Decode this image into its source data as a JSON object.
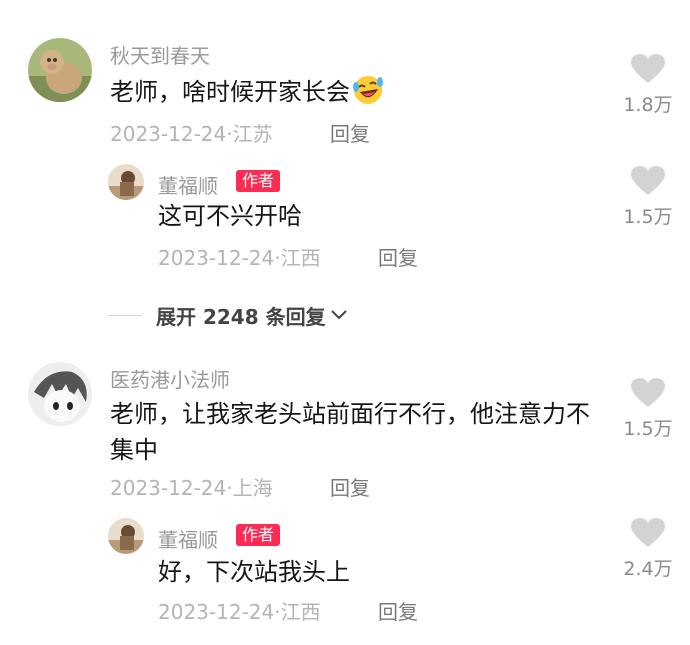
{
  "comments": [
    {
      "username": "秋天到春天",
      "content": "老师，啥时候开家长会",
      "emoji": "laughing-tears-emoji",
      "date": "2023-12-24",
      "location": "江苏",
      "reply_label": "回复",
      "likes": "1.8万",
      "reply": {
        "username": "董福顺",
        "badge": "作者",
        "content": "这可不兴开哈",
        "date": "2023-12-24",
        "location": "江西",
        "reply_label": "回复",
        "likes": "1.5万"
      },
      "expand_label": "展开 2248 条回复"
    },
    {
      "username": "医药港小法师",
      "content": "老师，让我家老头站前面行不行，他注意力不集中",
      "date": "2023-12-24",
      "location": "上海",
      "reply_label": "回复",
      "likes": "1.5万",
      "reply": {
        "username": "董福顺",
        "badge": "作者",
        "content": "好，下次站我头上",
        "date": "2023-12-24",
        "location": "江西",
        "reply_label": "回复",
        "likes": "2.4万"
      }
    }
  ],
  "colors": {
    "badge": "#fe2c55",
    "heart": "#d3d3d3"
  },
  "icons": {
    "like": "heart-icon",
    "expand": "chevron-down-icon"
  }
}
